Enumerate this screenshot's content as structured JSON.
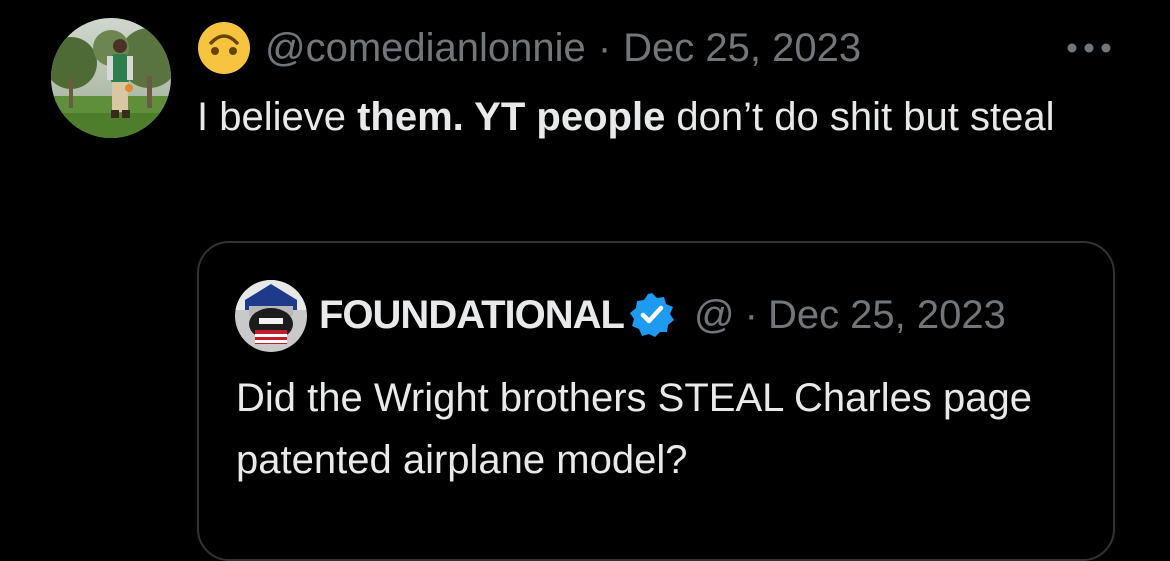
{
  "tweet": {
    "emoji_icon": "upside-down-face-emoji",
    "handle": "@comedianlonnie",
    "separator": "·",
    "date": "Dec 25, 2023",
    "more_icon": "more-dots-icon",
    "text_part1": "I believe ",
    "text_bold1": "them. YT people",
    "text_part2": " don’t do shit but steal"
  },
  "quote": {
    "display_name": "FOUNDATIONAL",
    "verified_icon": "verified-badge-icon",
    "verified_color": "#1d9bf0",
    "handle": "@",
    "separator": "·",
    "date": "Dec 25, 2023",
    "text": "Did the Wright brothers STEAL Charles page patented airplane model?"
  },
  "colors": {
    "background": "#000000",
    "text_primary": "#e7e9ea",
    "text_secondary": "#71767b",
    "border": "#2f3336"
  }
}
